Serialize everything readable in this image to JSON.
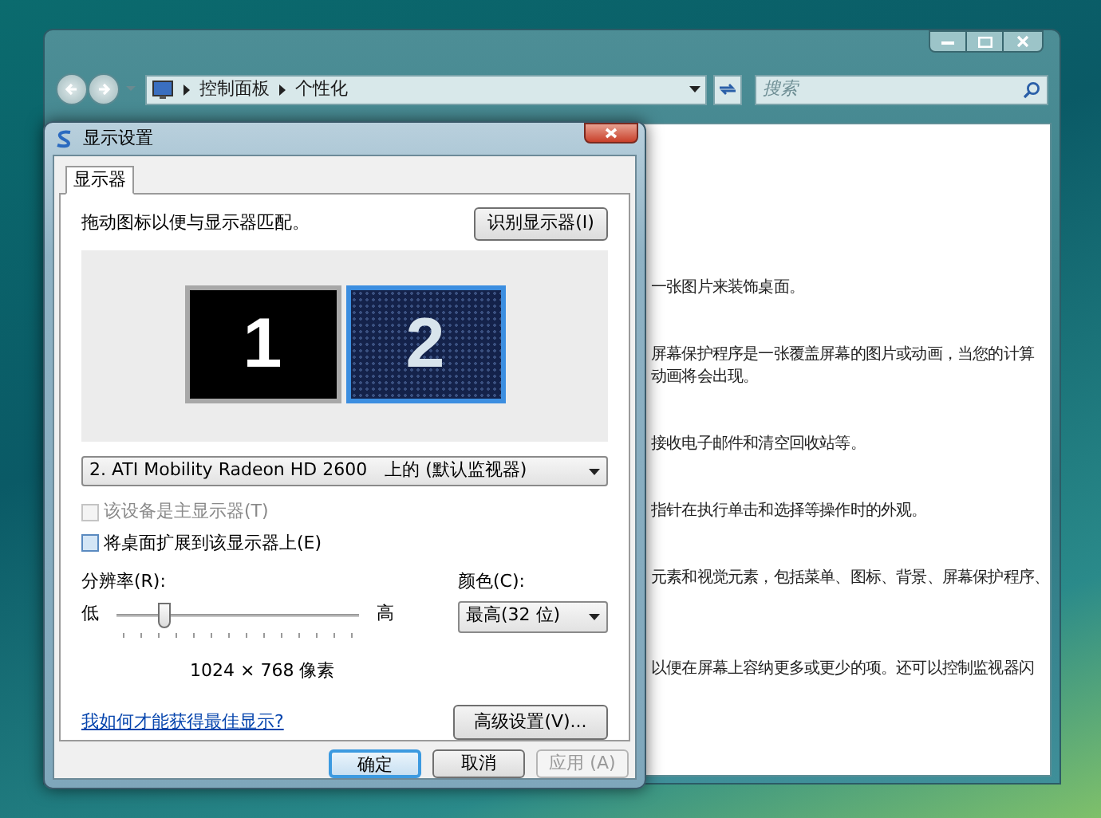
{
  "explorer": {
    "address_path": [
      "控制面板",
      "个性化"
    ],
    "search_placeholder": "搜索",
    "paragraphs": [
      [
        "一张图片来装饰桌面。"
      ],
      [
        "屏幕保护程序是一张覆盖屏幕的图片或动画，当您的计算",
        "动画将会出现。"
      ],
      [
        "接收电子邮件和清空回收站等。"
      ],
      [
        "指针在执行单击和选择等操作时的外观。"
      ],
      [
        "元素和视觉元素，包括菜单、图标、背景、屏幕保护程序、"
      ],
      [
        "以便在屏幕上容纳更多或更少的项。还可以控制监视器闪"
      ]
    ]
  },
  "dialog": {
    "title": "显示设置",
    "tabs": [
      {
        "label": "显示器",
        "selected": true
      }
    ],
    "instruction": "拖动图标以便与显示器匹配。",
    "identify_button": "识别显示器(I)",
    "monitors": [
      {
        "label": "1",
        "selected": false
      },
      {
        "label": "2",
        "selected": true
      }
    ],
    "display_select": "2. ATI Mobility Radeon HD 2600　上的 (默认监视器)",
    "options": [
      {
        "label": "该设备是主显示器(T)",
        "checked": false,
        "disabled": true
      },
      {
        "label": "将桌面扩展到该显示器上(E)",
        "checked": false,
        "disabled": false
      }
    ],
    "resolution": {
      "label": "分辨率(R):",
      "low": "低",
      "high": "高",
      "level": 0.18,
      "value_text": "1024 × 768 像素"
    },
    "color": {
      "label": "颜色(C):",
      "value": "最高(32 位)"
    },
    "help_link": "我如何才能获得最佳显示?",
    "advanced_button": "高级设置(V)...",
    "buttons": [
      {
        "label": "确定",
        "default": true,
        "disabled": false
      },
      {
        "label": "取消",
        "default": false,
        "disabled": false
      },
      {
        "label": "应用 (A)",
        "default": false,
        "disabled": true
      }
    ]
  }
}
